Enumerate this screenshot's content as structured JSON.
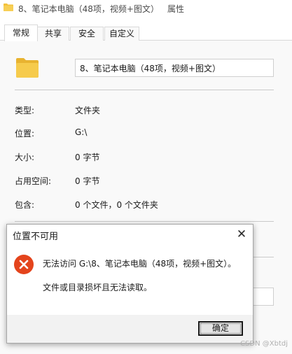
{
  "window": {
    "title": "8、笔记本电脑（48项，视频+图文）",
    "title_suffix": "属性",
    "folder_color": "#f3c23c"
  },
  "tabs": [
    {
      "label": "常规",
      "active": true
    },
    {
      "label": "共享",
      "active": false
    },
    {
      "label": "安全",
      "active": false
    },
    {
      "label": "自定义",
      "active": false
    }
  ],
  "general": {
    "name_value": "8、笔记本电脑（48项，视频+图文）",
    "rows": [
      {
        "label": "类型:",
        "value": "文件夹"
      },
      {
        "label": "位置:",
        "value": "G:\\"
      },
      {
        "label": "大小:",
        "value": "0 字节"
      },
      {
        "label": "占用空间:",
        "value": "0 字节"
      },
      {
        "label": "包含:",
        "value": "0 个文件，0 个文件夹"
      }
    ]
  },
  "dialog": {
    "title": "位置不可用",
    "close_icon": "close-icon",
    "error_icon": "error-icon",
    "error_color": "#e4441c",
    "message_line1": "无法访问 G:\\8、笔记本电脑（48项，视频+图文）。",
    "message_line2": "文件或目录损坏且无法读取。",
    "ok_label": "确定"
  },
  "watermark": "CSDN @Xbtdj"
}
